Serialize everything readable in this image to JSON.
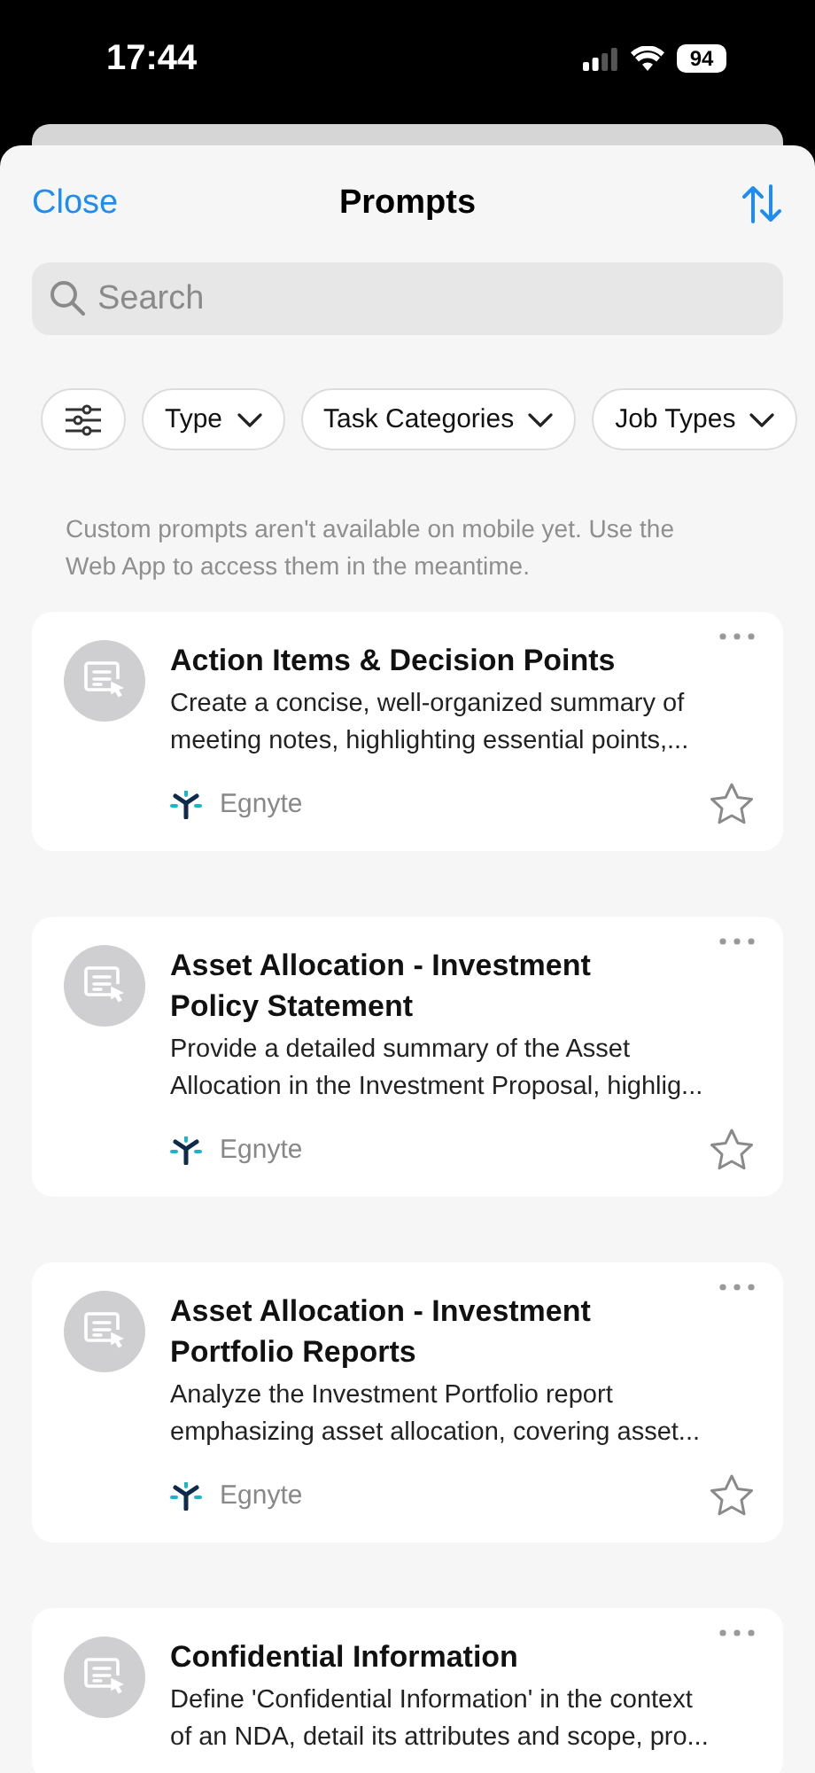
{
  "status_bar": {
    "time": "17:44",
    "battery": "94"
  },
  "header": {
    "close": "Close",
    "title": "Prompts"
  },
  "search": {
    "placeholder": "Search"
  },
  "filters": [
    {
      "label": "Type"
    },
    {
      "label": "Task Categories"
    },
    {
      "label": "Job Types"
    }
  ],
  "notice": "Custom prompts aren't available on mobile yet. Use the Web App to access them in the meantime.",
  "prompts": [
    {
      "title": "Action Items & Decision Points",
      "description": [
        "Create a concise, well-organized summary of",
        "meeting notes, highlighting essential points,..."
      ],
      "source": "Egnyte",
      "favorite": false
    },
    {
      "title": "Asset Allocation - Investment Policy Statement",
      "description": [
        "Provide a detailed summary of the Asset",
        "Allocation in the Investment Proposal, highlig..."
      ],
      "source": "Egnyte",
      "favorite": false
    },
    {
      "title": "Asset Allocation - Investment Portfolio Reports",
      "description": [
        "Analyze the Investment Portfolio report",
        "emphasizing asset allocation, covering asset..."
      ],
      "source": "Egnyte",
      "favorite": false
    },
    {
      "title": "Confidential Information",
      "description": [
        "Define 'Confidential Information' in the context",
        "of an NDA, detail its attributes and scope, pro..."
      ]
    }
  ]
}
